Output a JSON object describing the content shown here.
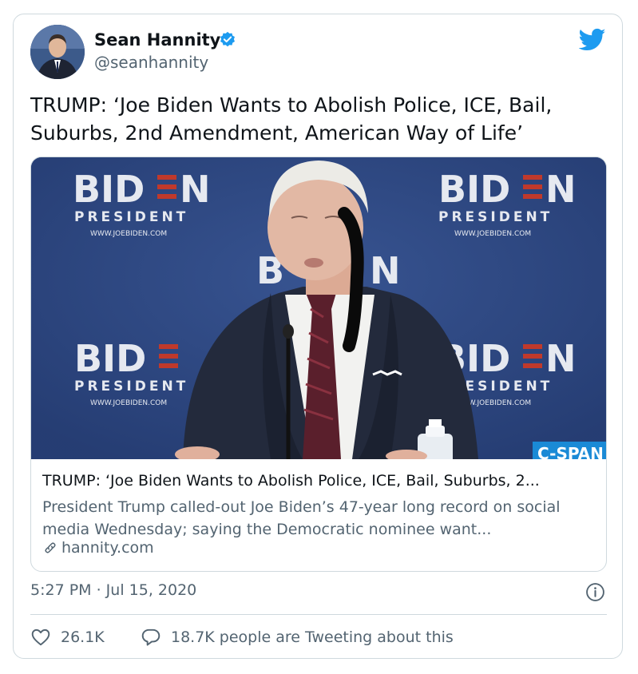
{
  "author": {
    "name": "Sean Hannity",
    "handle": "@seanhannity",
    "verified": true
  },
  "tweet": {
    "text": "TRUMP: ‘Joe Biden Wants to Abolish Police, ICE, Bail, Suburbs, 2nd Amendment, American Way of Life’"
  },
  "media": {
    "backdrop_logo_word": "BID",
    "backdrop_logo_end": "N",
    "backdrop_subtitle": "PRESIDENT",
    "backdrop_url": "WWW.JOEBIDEN.COM",
    "watermark": "C-SPAN",
    "colors": {
      "backdrop": "#2f4a86",
      "stripe": "#c0392b"
    }
  },
  "link_card": {
    "title": "TRUMP: ‘Joe Biden Wants to Abolish Police, ICE, Bail, Suburbs, 2...",
    "description": "President Trump called-out Joe Biden’s 47-year long record on social media Wednesday; saying the Democratic nominee want...",
    "domain": "hannity.com"
  },
  "meta": {
    "timestamp": "5:27 PM · Jul 15, 2020"
  },
  "actions": {
    "likes": "26.1K",
    "retweet_text": "18.7K people are Tweeting about this"
  },
  "colors": {
    "accent": "#1d9bf0",
    "secondary_text": "#536471",
    "border": "#cfd9de"
  },
  "icons": [
    "verified-badge-icon",
    "twitter-bird-icon",
    "link-icon",
    "info-icon",
    "heart-icon",
    "reply-bubble-icon"
  ]
}
